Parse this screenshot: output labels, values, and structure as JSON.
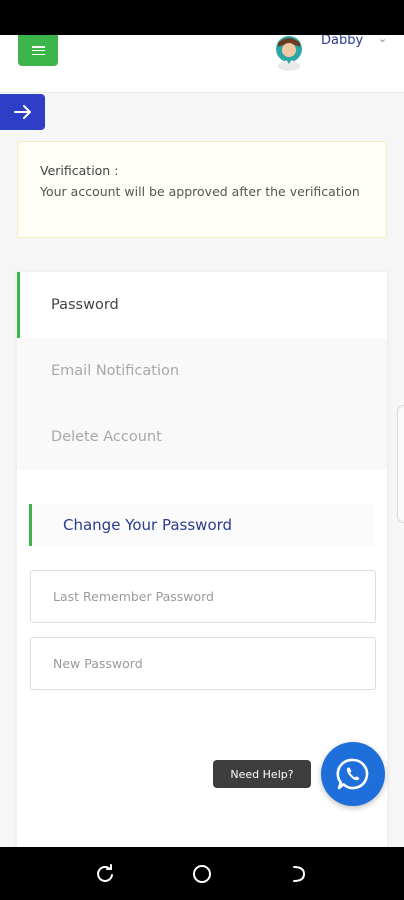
{
  "header": {
    "username": "Dabby",
    "menu_icon": "hamburger-menu-icon",
    "avatar_icon": "user-avatar-icon",
    "caret_icon": "chevron-down-icon",
    "caret_glyph": "⌄"
  },
  "side_toggle": {
    "icon": "arrow-right-icon"
  },
  "verification": {
    "title": "Verification :",
    "message": "Your account will be approved after the verification"
  },
  "settings_nav": {
    "items": [
      {
        "label": "Password",
        "active": true
      },
      {
        "label": "Email Notification",
        "active": false
      },
      {
        "label": "Delete Account",
        "active": false
      }
    ]
  },
  "password_section": {
    "heading": "Change Your Password",
    "last_password_placeholder": "Last Remember Password",
    "new_password_placeholder": "New Password"
  },
  "help": {
    "tooltip": "Need Help?",
    "icon": "whatsapp-icon"
  },
  "colors": {
    "accent_green": "#3cb54a",
    "brand_blue": "#2f3ec7",
    "heading_blue": "#2b3b8f",
    "whatsapp_blue": "#1e6fd9"
  },
  "system_nav": {
    "icons": [
      "recent-apps-icon",
      "home-icon",
      "back-icon"
    ]
  }
}
